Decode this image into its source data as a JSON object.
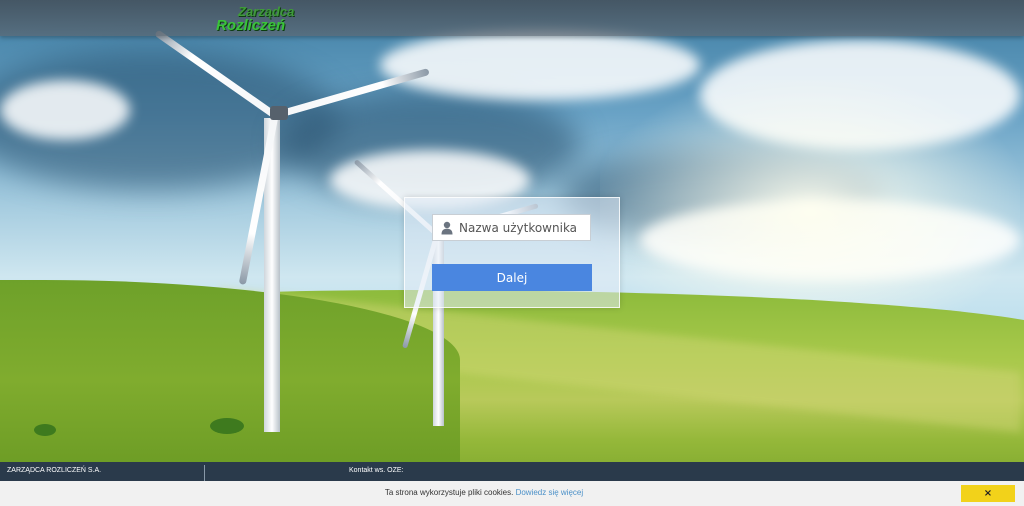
{
  "header": {
    "logo_line1": "Zarządca",
    "logo_line2": "Rozliczeń"
  },
  "login": {
    "username_placeholder": "Nazwa użytkownika",
    "username_value": "",
    "next_label": "Dalej"
  },
  "footer": {
    "company": "ZARZĄDCA ROZLICZEŃ S.A.",
    "contact": "Kontakt ws. OZE:"
  },
  "cookie": {
    "message": "Ta strona wykorzystuje pliki cookies.",
    "link_label": "Dowiedz się więcej",
    "close_label": "×"
  },
  "icons": [
    "user-icon",
    "close-icon"
  ]
}
